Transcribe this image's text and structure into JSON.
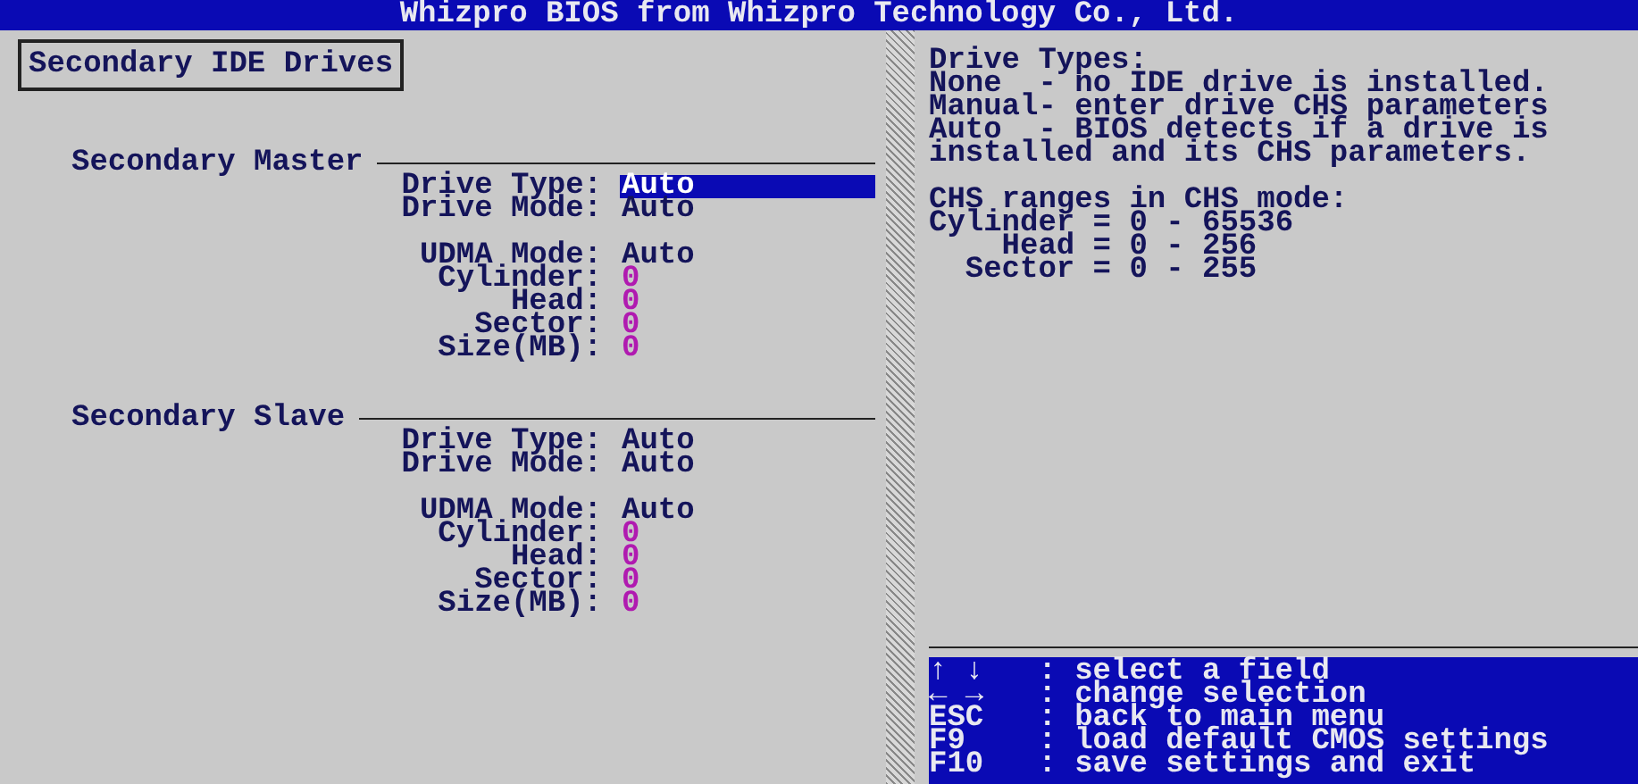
{
  "title": "Whizpro BIOS from Whizpro Technology Co., Ltd.",
  "section_title": "Secondary IDE Drives",
  "groups": [
    {
      "name": "Secondary Master",
      "drive": [
        {
          "label": "Drive Type:",
          "value": "Auto",
          "kind": "text",
          "selected": true
        },
        {
          "label": "Drive Mode:",
          "value": "Auto",
          "kind": "text",
          "selected": false
        }
      ],
      "details": [
        {
          "label": "UDMA Mode:",
          "value": "Auto",
          "kind": "text",
          "selected": false
        },
        {
          "label": "Cylinder:",
          "value": "0",
          "kind": "number",
          "selected": false
        },
        {
          "label": "Head:",
          "value": "0",
          "kind": "number",
          "selected": false
        },
        {
          "label": "Sector:",
          "value": "0",
          "kind": "number",
          "selected": false
        },
        {
          "label": "Size(MB):",
          "value": "0",
          "kind": "number",
          "selected": false
        }
      ]
    },
    {
      "name": "Secondary Slave",
      "drive": [
        {
          "label": "Drive Type:",
          "value": "Auto",
          "kind": "text",
          "selected": false
        },
        {
          "label": "Drive Mode:",
          "value": "Auto",
          "kind": "text",
          "selected": false
        }
      ],
      "details": [
        {
          "label": "UDMA Mode:",
          "value": "Auto",
          "kind": "text",
          "selected": false
        },
        {
          "label": "Cylinder:",
          "value": "0",
          "kind": "number",
          "selected": false
        },
        {
          "label": "Head:",
          "value": "0",
          "kind": "number",
          "selected": false
        },
        {
          "label": "Sector:",
          "value": "0",
          "kind": "number",
          "selected": false
        },
        {
          "label": "Size(MB):",
          "value": "0",
          "kind": "number",
          "selected": false
        }
      ]
    }
  ],
  "help": {
    "heading": "Drive Types:",
    "lines": [
      "None  - no IDE drive is installed.",
      "Manual- enter drive CHS parameters",
      "Auto  - BIOS detects if a drive is",
      "installed and its CHS parameters."
    ]
  },
  "ranges": {
    "heading": "CHS ranges in CHS mode:",
    "lines": [
      {
        "label": "Cylinder",
        "range": "= 0 - 65536"
      },
      {
        "label": "Head",
        "range": "= 0 - 256"
      },
      {
        "label": "Sector",
        "range": "= 0 - 255"
      }
    ]
  },
  "keys": [
    {
      "key": "↑ ↓",
      "action": ": select a field"
    },
    {
      "key": "← →",
      "action": ": change selection"
    },
    {
      "key": "ESC",
      "action": ": back to main menu"
    },
    {
      "key": "F9",
      "action": ": load default CMOS settings"
    },
    {
      "key": "F10",
      "action": ": save settings and exit"
    }
  ]
}
